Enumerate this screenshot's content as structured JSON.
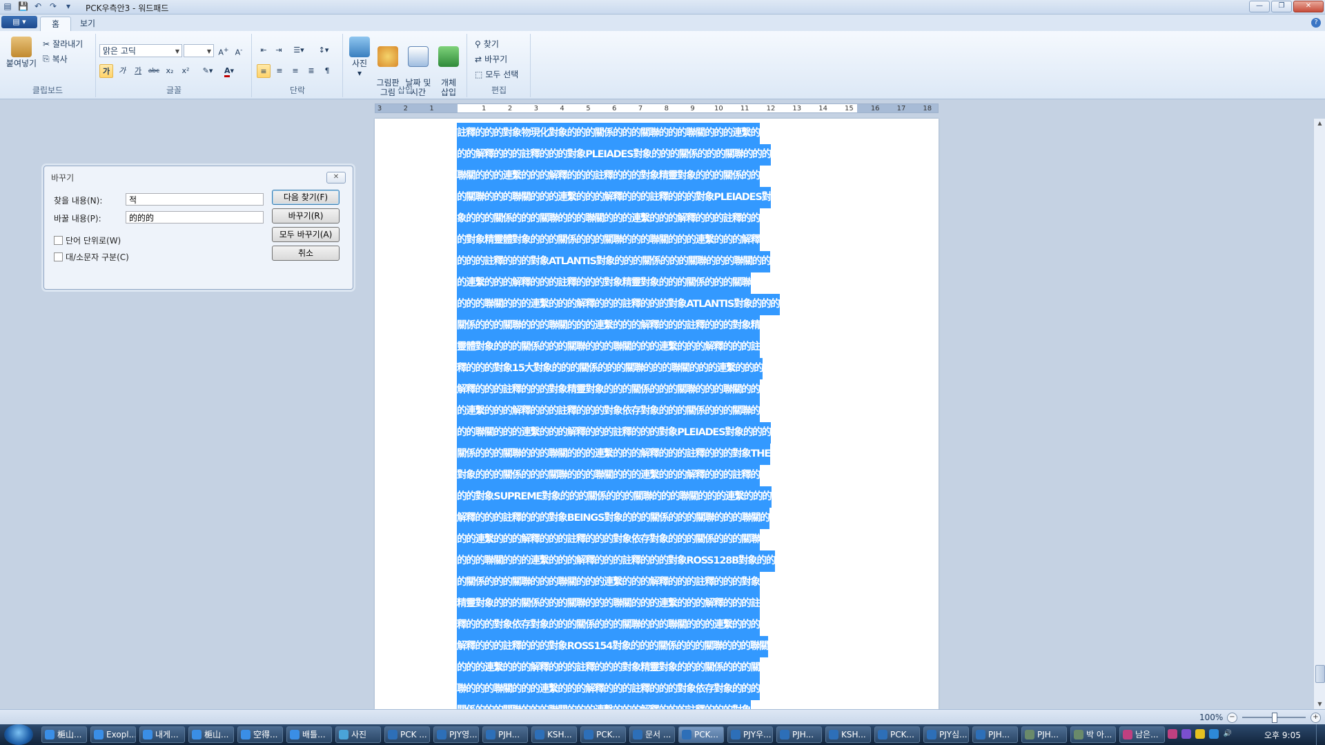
{
  "window": {
    "title": "PCK우측안3 - 워드패드",
    "qat_icons": [
      "save-icon",
      "undo-icon",
      "redo-icon",
      "customize-icon"
    ],
    "controls": [
      "minimize",
      "restore",
      "close"
    ]
  },
  "tabs": [
    {
      "label": "홈",
      "active": true
    },
    {
      "label": "보기",
      "active": false
    }
  ],
  "ribbon": {
    "clipboard": {
      "paste": "붙여넣기",
      "cut": "잘라내기",
      "copy": "복사",
      "label": "클립보드"
    },
    "font": {
      "family": "맑은 고딕",
      "size": "",
      "label": "글꼴",
      "buttons": [
        "가",
        "가",
        "가",
        "abc",
        "x₂",
        "x²"
      ]
    },
    "paragraph": {
      "label": "단락"
    },
    "insert": {
      "picture": "사진",
      "paint": "그림판\n그림",
      "datetime": "날짜 및\n시간",
      "object": "개체\n삽입",
      "label": "삽입"
    },
    "editing": {
      "find": "찾기",
      "replace": "바꾸기",
      "select_all": "모두 선택",
      "label": "편집"
    }
  },
  "ruler": {
    "labels": [
      "3",
      "2",
      "1",
      "",
      "1",
      "2",
      "3",
      "4",
      "5",
      "6",
      "7",
      "8",
      "9",
      "10",
      "11",
      "12",
      "13",
      "14",
      "15",
      "16",
      "17",
      "18"
    ]
  },
  "document": {
    "lines": [
      "註釋的的的對象物現化對象的的的關係的的的關聯的的的聯關的的的連繫的",
      "的的解釋的的的註釋的的的對象PLEIADES對象的的的關係的的的關聯的的的",
      "聯關的的的連繫的的的解釋的的的註釋的的的對象精靈對象的的的關係的的",
      "的關聯的的的聯關的的的連繫的的的解釋的的的註釋的的的對象PLEIADES對",
      "象的的的關係的的的關聯的的的聯關的的的連繫的的的解釋的的的註釋的的",
      "的對象精靈體對象的的的關係的的的關聯的的的聯關的的的連繫的的的解釋",
      "的的的註釋的的的對象ATLANTIS對象的的的關係的的的關聯的的的聯關的的",
      "的連繫的的的解釋的的的註釋的的的對象精靈對象的的的關係的的的關聯",
      "的的的聯關的的的連繫的的的解釋的的的註釋的的的對象ATLANTIS對象的的的",
      "關係的的的關聯的的的聯關的的的連繫的的的解釋的的的註釋的的的對象精",
      "靈體對象的的的關係的的的關聯的的的聯關的的的連繫的的的解釋的的的註",
      "釋的的的對象15大對象的的的關係的的的關聯的的的聯關的的的連繫的的的",
      "解釋的的的註釋的的的對象精靈對象的的的關係的的的關聯的的的聯關的的",
      "的連繫的的的解釋的的的註釋的的的對象依存對象的的的關係的的的關聯的",
      "的的聯關的的的連繫的的的解釋的的的註釋的的的對象PLEIADES對象的的的",
      "關係的的的關聯的的的聯關的的的連繫的的的解釋的的的註釋的的的對象THE",
      "對象的的的關係的的的關聯的的的聯關的的的連繫的的的解釋的的的註釋的",
      "的的對象SUPREME對象的的的關係的的的關聯的的的聯關的的的連繫的的的",
      "解釋的的的註釋的的的對象BEINGS對象的的的關係的的的關聯的的的聯關的",
      "的的連繫的的的解釋的的的註釋的的的對象依存對象的的的關係的的的關聯",
      "的的的聯關的的的連繫的的的解釋的的的註釋的的的對象ROSS128B對象的的",
      "的關係的的的關聯的的的聯關的的的連繫的的的解釋的的的註釋的的的對象",
      "精靈對象的的的關係的的的關聯的的的聯關的的的連繫的的的解釋的的的註",
      "釋的的的對象依存對象的的的關係的的的關聯的的的聯關的的的連繫的的的",
      "解釋的的的註釋的的的對象ROSS154對象的的的關係的的的關聯的的的聯關",
      "的的的連繫的的的解釋的的的註釋的的的對象精靈對象的的的關係的的的關",
      "聯的的的聯關的的的連繫的的的解釋的的的註釋的的的對象依存對象的的的",
      "關係的的的關聯的的的聯關的的的連繫的的的解釋的的的註釋的的的對象"
    ]
  },
  "dialog": {
    "title": "바꾸기",
    "find_label": "찾을 내용(N):",
    "find_value": "적",
    "replace_label": "바꿀 내용(P):",
    "replace_value": "的的的",
    "whole_word": "단어 단위로(W)",
    "match_case": "대/소문자 구분(C)",
    "btn_find_next": "다음 찾기(F)",
    "btn_replace": "바꾸기(R)",
    "btn_replace_all": "모두 바꾸기(A)",
    "btn_cancel": "취소"
  },
  "statusbar": {
    "zoom": "100%",
    "zoom_level": 0.5
  },
  "taskbar": {
    "tasks": [
      {
        "label": "梔山...",
        "color": "#3a8ee6"
      },
      {
        "label": "Exopl...",
        "color": "#3a8ee6"
      },
      {
        "label": "내게...",
        "color": "#3a8ee6"
      },
      {
        "label": "梔山...",
        "color": "#3a8ee6"
      },
      {
        "label": "空得...",
        "color": "#3a8ee6"
      },
      {
        "label": "배틀...",
        "color": "#3a8ee6"
      },
      {
        "label": "사진",
        "color": "#4aa3d8"
      },
      {
        "label": "PCK ...",
        "color": "#2d6fb8"
      },
      {
        "label": "PJY영...",
        "color": "#2d6fb8"
      },
      {
        "label": "PJH...",
        "color": "#2d6fb8"
      },
      {
        "label": "KSH...",
        "color": "#2d6fb8"
      },
      {
        "label": "PCK...",
        "color": "#2d6fb8"
      },
      {
        "label": "문서 ...",
        "color": "#2d6fb8"
      },
      {
        "label": "PCK...",
        "color": "#2d6fb8"
      },
      {
        "label": "PJY우...",
        "color": "#2d6fb8"
      },
      {
        "label": "PJH...",
        "color": "#2d6fb8"
      },
      {
        "label": "KSH...",
        "color": "#2d6fb8"
      },
      {
        "label": "PCK...",
        "color": "#2d6fb8"
      },
      {
        "label": "PJY심...",
        "color": "#2d6fb8"
      },
      {
        "label": "PJH...",
        "color": "#2d6fb8"
      },
      {
        "label": "PJH...",
        "color": "#6a8a6a"
      },
      {
        "label": "박 아...",
        "color": "#6a8a6a"
      },
      {
        "label": "남은...",
        "color": "#c04080"
      }
    ],
    "clock": "오후 9:05"
  },
  "colors": {
    "selection": "#3399ff",
    "selection_text": "#ffffff"
  }
}
